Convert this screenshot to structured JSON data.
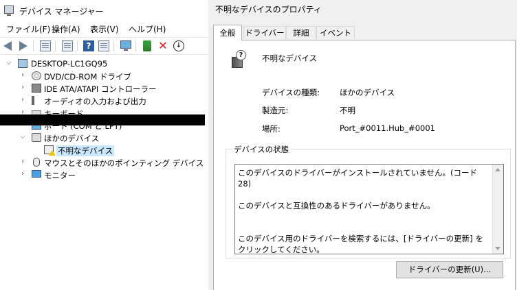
{
  "device_manager": {
    "title": "デバイス マネージャー",
    "menu": [
      "ファイル(F)",
      "操作(A)",
      "表示(V)",
      "ヘルプ(H)"
    ],
    "toolbar_icons": [
      "back-icon",
      "forward-icon",
      "properties-grid-icon",
      "list-view-icon",
      "help-icon",
      "view-icon",
      "monitor-icon",
      "update-driver-icon",
      "uninstall-icon",
      "download-icon"
    ],
    "tree": {
      "root": "DESKTOP-LC1GQ95",
      "items": [
        {
          "label": "DVD/CD-ROM ドライブ",
          "expanded": false
        },
        {
          "label": "IDE ATA/ATAPI コントローラー",
          "expanded": false
        },
        {
          "label": "オーディオの入力および出力",
          "expanded": false
        },
        {
          "label": "キーボード",
          "expanded": false
        },
        {
          "label": "ポート (COM と LPT)",
          "expanded": false
        },
        {
          "label": "ほかのデバイス",
          "expanded": true
        },
        {
          "label": "不明なデバイス",
          "selected": true,
          "warning": true
        },
        {
          "label": "マウスとそのほかのポインティング デバイス",
          "expanded": false
        },
        {
          "label": "モニター",
          "expanded": false
        }
      ]
    }
  },
  "properties": {
    "title": "不明なデバイスのプロパティ",
    "tabs": [
      "全般",
      "ドライバー",
      "詳細",
      "イベント"
    ],
    "active_tab": "全般",
    "device_name": "不明なデバイス",
    "fields": [
      {
        "label": "デバイスの種類:",
        "value": "ほかのデバイス"
      },
      {
        "label": "製造元:",
        "value": "不明"
      },
      {
        "label": "場所:",
        "value": "Port_#0011.Hub_#0001"
      }
    ],
    "status_legend": "デバイスの状態",
    "status_text": "このデバイスのドライバーがインストールされていません。(コード 28)\n\nこのデバイスと互換性のあるドライバーがありません。\n\n\nこのデバイス用のドライバーを検索するには、[ドライバーの更新] をクリックしてください。",
    "update_button": "ドライバーの更新(U)..."
  },
  "colors": {
    "selection": "#cce8ff",
    "dialog_bg": "#f0f0f0",
    "warning": "#f2c400"
  }
}
